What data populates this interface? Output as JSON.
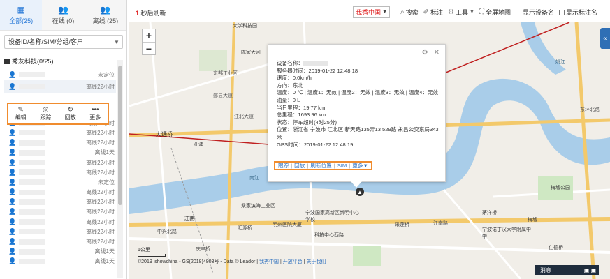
{
  "left_panel": {
    "tabs": [
      {
        "label": "全部(25)",
        "icon": "grid-icon",
        "active": true
      },
      {
        "label": "在线 (0)",
        "icon": "users-icon",
        "active": false
      },
      {
        "label": "离线 (25)",
        "icon": "users-icon",
        "active": false
      }
    ],
    "search": {
      "placeholder": "设备ID/名称/SIM/分组/客户"
    },
    "group": {
      "label": "秀友科技(0/25)"
    },
    "device_rows": [
      {
        "status": "未定位"
      },
      {
        "status": "离线22小时",
        "selected": true
      }
    ],
    "actions": [
      {
        "label": "编辑",
        "icon": "edit-icon"
      },
      {
        "label": "跟踪",
        "icon": "target-icon"
      },
      {
        "label": "回放",
        "icon": "replay-icon"
      },
      {
        "label": "更多",
        "icon": "more-icon"
      }
    ],
    "more_rows": [
      {
        "status": "离线22小时"
      },
      {
        "status": "离线22小时"
      },
      {
        "status": "离线22小时"
      },
      {
        "status": "离线1天"
      },
      {
        "status": "离线22小时"
      },
      {
        "status": "离线22小时"
      },
      {
        "status": "未定位"
      },
      {
        "status": "离线22小时"
      },
      {
        "status": "离线22小时"
      },
      {
        "status": "离线22小时"
      },
      {
        "status": "离线22小时"
      },
      {
        "status": "离线22小时"
      },
      {
        "status": "离线22小时"
      },
      {
        "status": "离线1天"
      },
      {
        "status": "离线1天"
      }
    ]
  },
  "toolbar": {
    "refresh_count": "1",
    "refresh_label": "秒后刷新",
    "map_select": "我秀中国",
    "search": "搜索",
    "mark": "标注",
    "tools": "工具",
    "fullscreen": "全屏地图",
    "show_device_name": "显示设备名",
    "show_marker_name": "显示标注名"
  },
  "map": {
    "zoom_in": "+",
    "zoom_out": "−",
    "labels": {
      "l1": "大学科技园",
      "l2": "陈家大河",
      "l3": "东邦工业区",
      "l4": "鄞县大道",
      "l5": "孔浦",
      "l6": "大通桥",
      "l7": "南江",
      "l8": "姚江",
      "l9": "梅墟公园",
      "l10": "梅墟",
      "l11": "茅洋桥",
      "l12": "江南",
      "l13": "宁波国家高新区新明中心学校",
      "l14": "桑家滨海工业区",
      "l15": "明州医院大厦",
      "l16": "科技中心西路",
      "l17": "宁波诺丁汉大学附属中学",
      "l18": "江南路",
      "l19": "采莲桥",
      "l20": "仁德桥",
      "l21": "东环北路",
      "l22": "汇源桥",
      "l23": "中兴北路",
      "l24": "江北大道",
      "l25": "庆丰桥"
    },
    "scale": "1公里",
    "copyright_text": "©2019 ishowchina - GS(2018)4803号 - Data © Leador |",
    "copyright_link1": "我秀中国",
    "copyright_link2": "开放平台",
    "copyright_link3": "关于我们",
    "message_bar": "消息"
  },
  "popup": {
    "device_name_label": "设备名称：",
    "server_time": "服务器时间：2019-01-22 12:48:18",
    "speed": "速度：0.0km/h",
    "direction": "方向：东北",
    "temperature": "温度：0 ℃ | 温度1：无效 | 温度2：无效 | 温度3：无效 | 温度4：无效",
    "oil": "油量：0 L",
    "day_mileage": "当日里程：19.77 km",
    "total_mileage": "总里程：1693.96 km",
    "state": "状态：停车超时(4时25分)",
    "location": "位置：浙江省 宁波市 江北区 新天路135弄13 529路 永昌公交东局343米",
    "gps_time": "GPS时间：2019-01-22 12:48:19",
    "links": [
      "跟踪",
      "回放",
      "刷新位置",
      "SIM",
      "更多▼"
    ]
  },
  "colors": {
    "accent_orange": "#f08c2e",
    "link_blue": "#2b6ebd",
    "refresh_red": "#e02020",
    "water": "#a9cde9"
  }
}
